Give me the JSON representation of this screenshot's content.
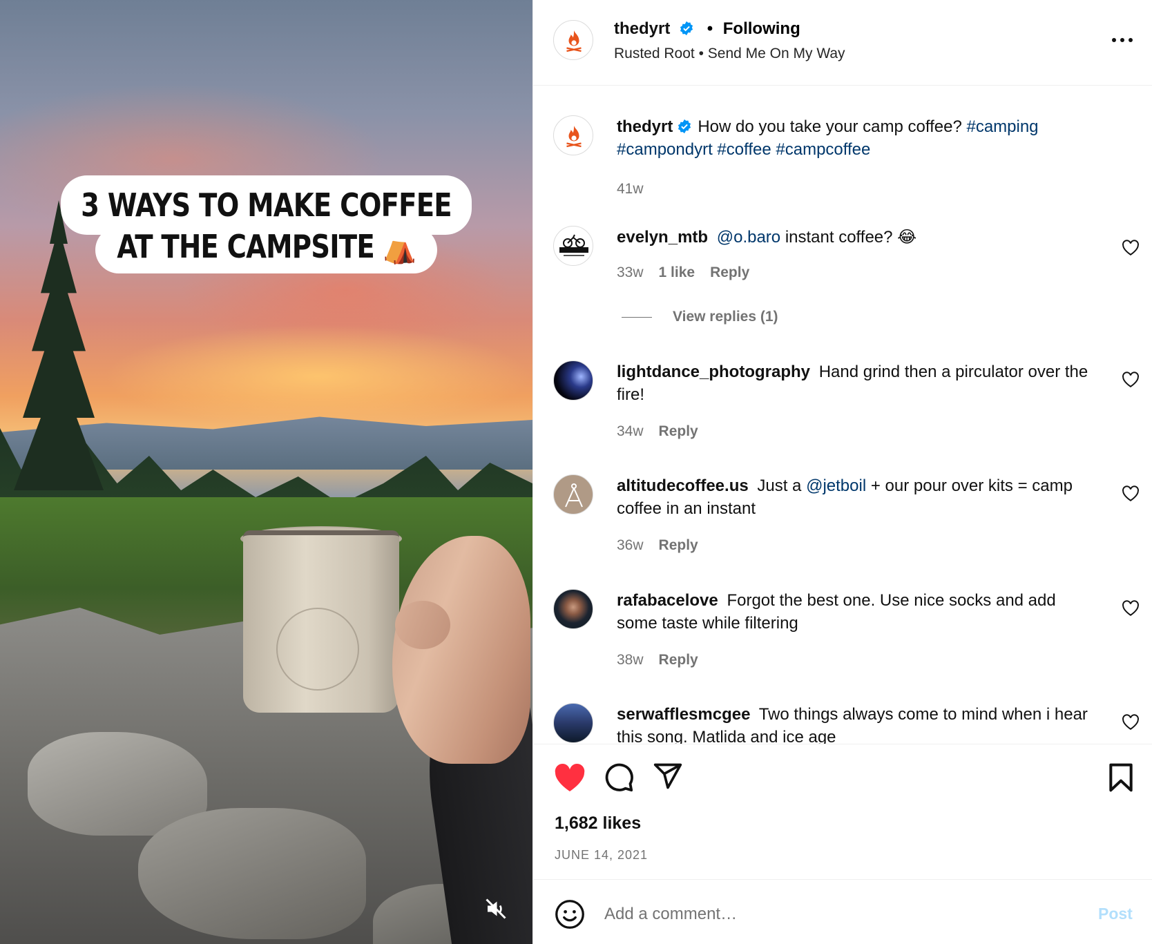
{
  "media": {
    "caption_line1": "3 WAYS TO MAKE COFFEE",
    "caption_line2": "AT THE CAMPSITE ⛺",
    "mute_icon": "muted-speaker-icon"
  },
  "header": {
    "username": "thedyrt",
    "separator": "•",
    "follow_status": "Following",
    "audio": "Rusted Root • Send Me On My Way",
    "more_icon": "more-horizontal-icon"
  },
  "post": {
    "username": "thedyrt",
    "caption": "How do you take your camp coffee?",
    "hashtags": [
      "#camping",
      "#campondyrt",
      "#coffee",
      "#campcoffee"
    ],
    "age": "41w"
  },
  "comments": [
    {
      "username": "evelyn_mtb",
      "mention": "@o.baro",
      "text": "instant coffee? 😂",
      "age": "33w",
      "likes": "1 like",
      "reply": "Reply",
      "view_replies": "View replies (1)"
    },
    {
      "username": "lightdance_photography",
      "text": "Hand grind then a pirculator over the fire!",
      "age": "34w",
      "reply": "Reply"
    },
    {
      "username": "altitudecoffee.us",
      "text_before": "Just a",
      "mention": "@jetboil",
      "text_after": "+ our pour over kits = camp coffee in an instant",
      "age": "36w",
      "reply": "Reply"
    },
    {
      "username": "rafabacelove",
      "text": "Forgot the best one. Use nice socks and add some taste while filtering",
      "age": "38w",
      "reply": "Reply"
    },
    {
      "username": "serwafflesmcgee",
      "text": "Two things always come to mind when i hear this song. Matlida and ice age"
    }
  ],
  "actions": {
    "like_icon": "heart-filled-icon",
    "comment_icon": "comment-icon",
    "share_icon": "share-plane-icon",
    "save_icon": "bookmark-icon",
    "likes": "1,682 likes",
    "date": "JUNE 14, 2021"
  },
  "add_comment": {
    "placeholder": "Add a comment…",
    "post_label": "Post",
    "emoji_icon": "emoji-icon"
  },
  "colors": {
    "like_red": "#ff3040",
    "link_blue": "#00376b",
    "verified_blue": "#0095f6",
    "post_button": "#b2dffc",
    "brand_orange": "#e8541c"
  }
}
